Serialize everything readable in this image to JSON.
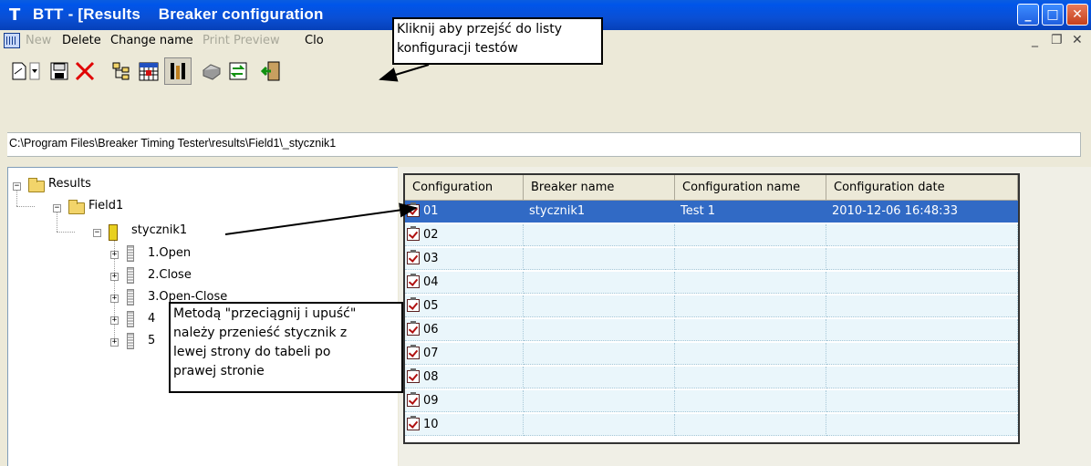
{
  "window": {
    "title": "BTT - [Results    Breaker configuration",
    "app_icon": "tower-icon",
    "controls": [
      "minimize",
      "maximize",
      "close"
    ]
  },
  "menu": {
    "items": [
      {
        "label": "New",
        "enabled": false
      },
      {
        "label": "Delete",
        "enabled": true
      },
      {
        "label": "Change name",
        "enabled": true
      },
      {
        "label": "Print Preview",
        "enabled": false
      },
      {
        "label": "Clo",
        "enabled": true
      }
    ],
    "mdi_controls": [
      "_",
      "❐",
      "✕"
    ]
  },
  "toolbar": {
    "buttons": [
      "new-document-icon",
      "dropdown-arrow-icon",
      "save-icon",
      "delete-icon",
      "tree-view-icon",
      "calendar-icon",
      "configuration-icon",
      "print-icon",
      "export-icon",
      "exit-icon"
    ]
  },
  "path": "C:\\Program Files\\Breaker Timing Tester\\results\\Field1\\_stycznik1",
  "tree": {
    "root": "Results",
    "field": "Field1",
    "breaker": "stycznik1",
    "children": [
      "1.Open",
      "2.Close",
      "3.Open-Close",
      "4",
      "5"
    ]
  },
  "table": {
    "columns": [
      "Configuration",
      "Breaker name",
      "Configuration name",
      "Configuration date"
    ],
    "rows": [
      {
        "configuration": "01",
        "breaker_name": "stycznik1",
        "configuration_name": "Test 1",
        "configuration_date": "2010-12-06 16:48:33",
        "selected": true
      },
      {
        "configuration": "02",
        "breaker_name": "",
        "configuration_name": "",
        "configuration_date": ""
      },
      {
        "configuration": "03",
        "breaker_name": "",
        "configuration_name": "",
        "configuration_date": ""
      },
      {
        "configuration": "04",
        "breaker_name": "",
        "configuration_name": "",
        "configuration_date": ""
      },
      {
        "configuration": "05",
        "breaker_name": "",
        "configuration_name": "",
        "configuration_date": ""
      },
      {
        "configuration": "06",
        "breaker_name": "",
        "configuration_name": "",
        "configuration_date": ""
      },
      {
        "configuration": "07",
        "breaker_name": "",
        "configuration_name": "",
        "configuration_date": ""
      },
      {
        "configuration": "08",
        "breaker_name": "",
        "configuration_name": "",
        "configuration_date": ""
      },
      {
        "configuration": "09",
        "breaker_name": "",
        "configuration_name": "",
        "configuration_date": ""
      },
      {
        "configuration": "10",
        "breaker_name": "",
        "configuration_name": "",
        "configuration_date": ""
      }
    ]
  },
  "callouts": {
    "top": [
      "Kliknij aby przejść do listy",
      "konfiguracji testów"
    ],
    "bottom": [
      "Metodą \"przeciągnij i upuść\"",
      "należy przenieść stycznik z",
      "lewej strony do tabeli po",
      "prawej stronie"
    ]
  },
  "colors": {
    "selection": "#316ac5",
    "titlebar": "#0a4fd4",
    "row_bg": "#eaf6fb"
  }
}
